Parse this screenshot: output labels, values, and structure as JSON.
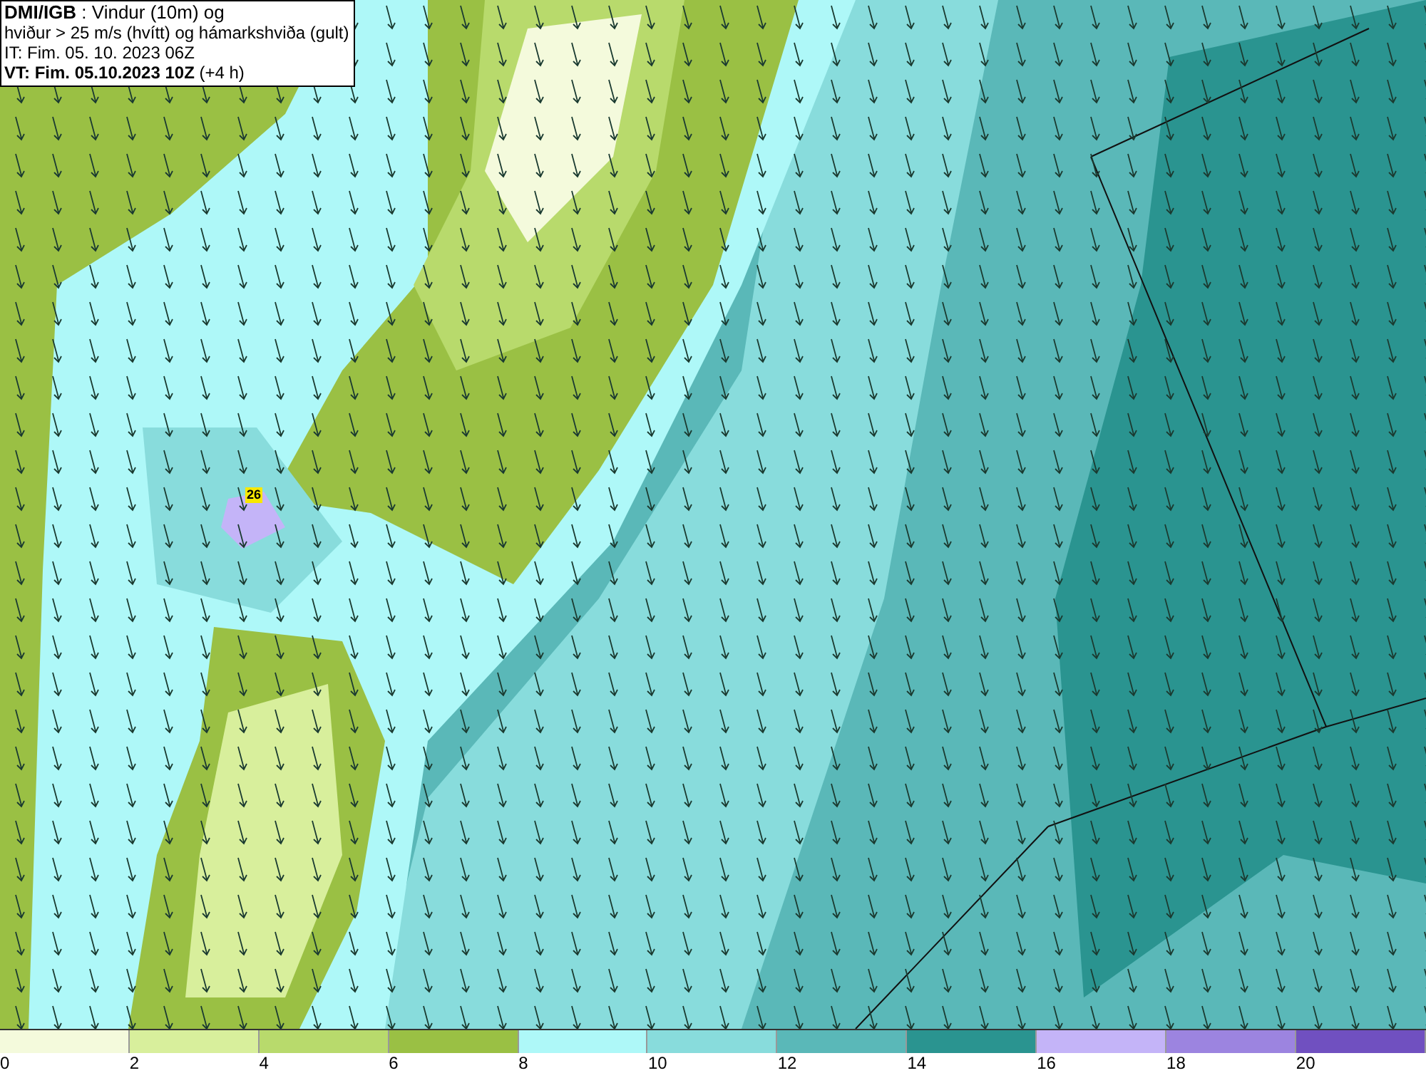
{
  "title_box": {
    "lines": [
      "**DMI/IGB** : Vindur (10m) og",
      "hviður > 25 m/s (hvítt) og hámarkshviða (gult)",
      "IT: Fim. 05. 10. 2023 06Z",
      "**VT: Fim. 05.10.2023 10Z** (+4 h)"
    ]
  },
  "map": {
    "markers": [
      {
        "label": "26",
        "color": "#f8e800"
      }
    ]
  },
  "legend": {
    "bins": [
      {
        "color": "#f4fadc"
      },
      {
        "color": "#d8ef9c"
      },
      {
        "color": "#b8da6c"
      },
      {
        "color": "#9ac044"
      },
      {
        "color": "#aef8f8"
      },
      {
        "color": "#88dcdc"
      },
      {
        "color": "#5ab8b8"
      },
      {
        "color": "#2a9490"
      },
      {
        "color": "#c4b4f8"
      },
      {
        "color": "#9c84e0"
      },
      {
        "color": "#7050c0"
      }
    ],
    "ticks": [
      "0",
      "2",
      "4",
      "6",
      "8",
      "10",
      "12",
      "14",
      "16",
      "18",
      "20"
    ]
  }
}
